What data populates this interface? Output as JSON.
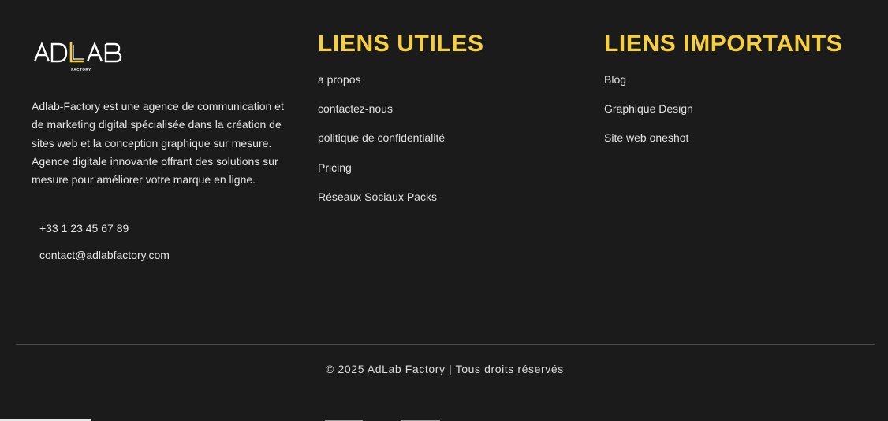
{
  "brand": {
    "logo_main": "ADLAB",
    "logo_sub": "FACTORY",
    "accent_color": "#f6cf3f",
    "background_color": "#1b1b1b"
  },
  "about": {
    "description": "Adlab-Factory est une agence de communication et de marketing digital spécialisée dans la création de sites web et la conception graphique sur mesure. Agence digitale innovante offrant des solutions sur mesure pour améliorer votre marque en ligne.",
    "phone": "+33 1 23 45 67 89",
    "email": "contact@adlabfactory.com"
  },
  "useful_links": {
    "title": "LIENS UTILES",
    "items": [
      {
        "label": "a propos"
      },
      {
        "label": "contactez-nous"
      },
      {
        "label": "politique de confidentialité"
      },
      {
        "label": "Pricing"
      },
      {
        "label": "Réseaux Sociaux Packs"
      }
    ]
  },
  "important_links": {
    "title": "LIENS IMPORTANTS",
    "items": [
      {
        "label": "Blog"
      },
      {
        "label": "Graphique Design"
      },
      {
        "label": "Site web oneshot"
      }
    ]
  },
  "footer": {
    "copyright": "© 2025 AdLab Factory | Tous droits réservés"
  }
}
